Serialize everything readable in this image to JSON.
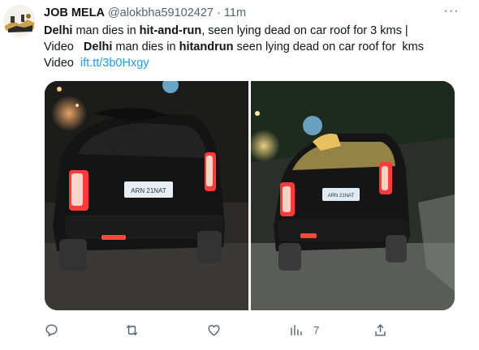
{
  "tweet": {
    "display_name": "JOB MELA",
    "handle": "@alokbha59102427",
    "separator": "·",
    "time": "11m",
    "more_label": "···",
    "text": {
      "p1_b1": "Delhi",
      "p1_t1": " man dies in ",
      "p1_b2": "hit-and-run",
      "p1_t2": ", seen lying dead on car roof for 3 kms |",
      "p2_t1": "Video   ",
      "p2_b1": "Delhi",
      "p2_t2": " man dies in ",
      "p2_b2": "hitandrun",
      "p2_t3": " seen lying dead on car roof for  kms",
      "p3_t1": "Video  ",
      "link": "ift.tt/3b0Hxgy"
    },
    "media": {
      "left_plate": "ARN 21NAT",
      "right_plate": "ARN 21NAT"
    },
    "actions": {
      "reply_icon": "reply-icon",
      "retweet_icon": "retweet-icon",
      "like_icon": "heart-icon",
      "views_icon": "views-icon",
      "views_count": "7",
      "share_icon": "share-icon"
    },
    "colors": {
      "link": "#1d9bf0",
      "secondary_text": "#536471",
      "primary_text": "#0f1419"
    }
  }
}
